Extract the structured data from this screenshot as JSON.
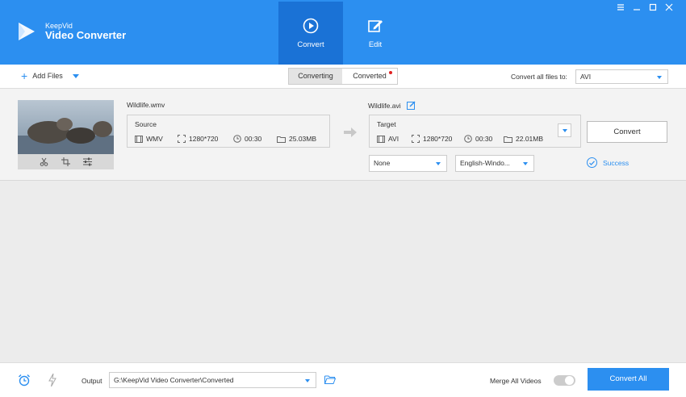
{
  "app": {
    "brand_small": "KeepVid",
    "brand_big": "Video Converter"
  },
  "nav": {
    "convert_label": "Convert",
    "edit_label": "Edit"
  },
  "toolbar": {
    "add_files_label": "Add Files",
    "tab_converting": "Converting",
    "tab_converted": "Converted",
    "convert_all_files_label": "Convert all files to:",
    "convert_all_format": "AVI"
  },
  "file": {
    "source_name": "Wildlife.wmv",
    "source_title": "Source",
    "source_format": "WMV",
    "source_resolution": "1280*720",
    "source_duration": "00:30",
    "source_size": "25.03MB",
    "target_name": "Wildlife.avi",
    "target_title": "Target",
    "target_format": "AVI",
    "target_resolution": "1280*720",
    "target_duration": "00:30",
    "target_size": "22.01MB",
    "subtitle_select": "None",
    "audio_select": "English-Windo...",
    "convert_button": "Convert",
    "status": "Success"
  },
  "footer": {
    "output_label": "Output",
    "output_path": "G:\\KeepVid Video Converter\\Converted",
    "merge_label": "Merge All Videos",
    "merge_enabled": false,
    "convert_all_button": "Convert All"
  },
  "colors": {
    "accent": "#2c8ff0",
    "accent_dark": "#1a72d6",
    "notification_dot": "#e02020"
  }
}
